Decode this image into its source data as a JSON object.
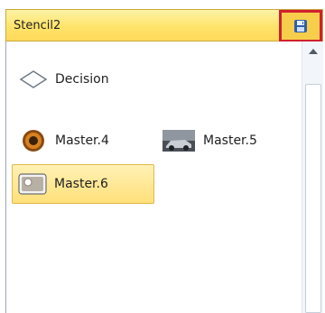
{
  "stencil": {
    "title": "Stencil2",
    "save_icon": "save-disk-icon",
    "items": [
      {
        "label": "Decision",
        "icon": "diamond-shape-icon"
      },
      {
        "label": "Master.4",
        "icon": "circle-photo-icon"
      },
      {
        "label": "Master.5",
        "icon": "car-photo-icon"
      },
      {
        "label": "Master.6",
        "icon": "rounded-rectangle-photo-icon",
        "selected": true
      }
    ]
  },
  "colors": {
    "title_bar": "#ffe46a",
    "highlight_border": "#d0202e",
    "selected_item": "#ffe07a"
  }
}
